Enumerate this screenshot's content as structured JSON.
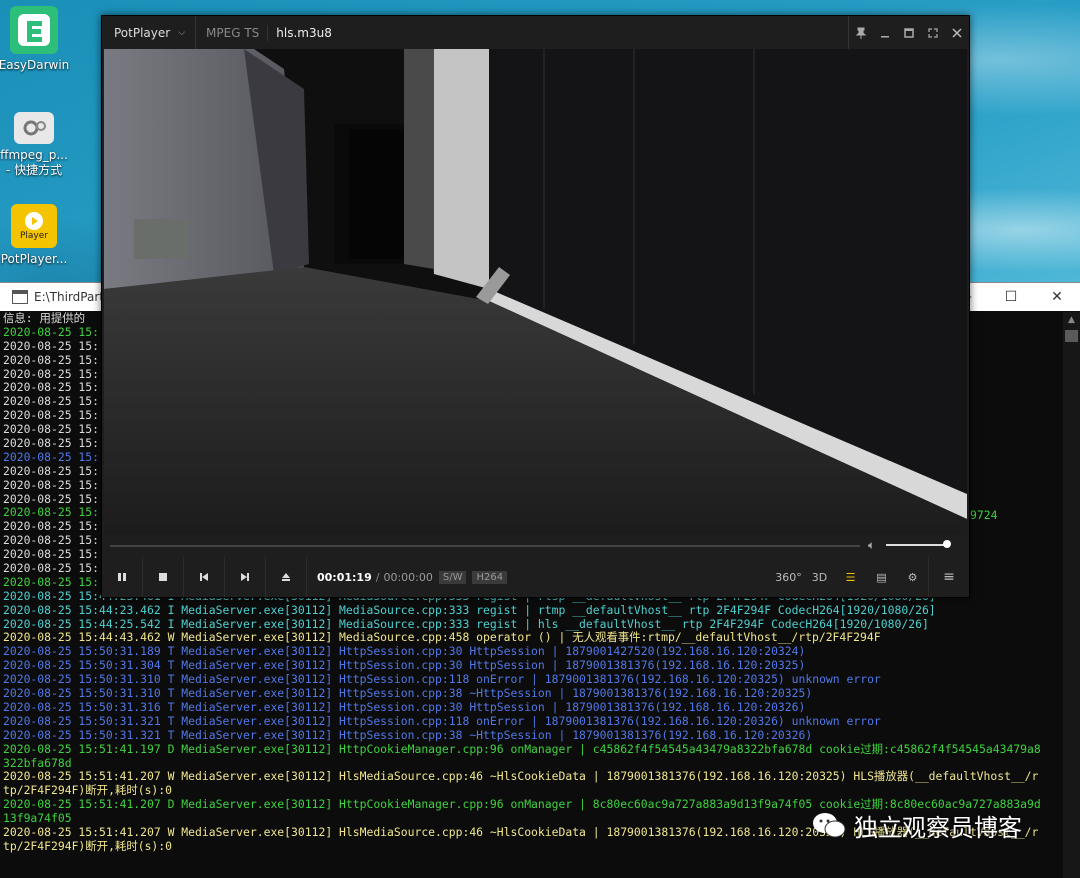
{
  "desktop": {
    "icons": [
      {
        "label": "EasyDarwin"
      },
      {
        "label": "ffmpeg_p...\n- 快捷方式"
      },
      {
        "label": "PotPlayer..."
      }
    ],
    "potplayer_icon_text": "Player"
  },
  "console": {
    "title": "E:\\ThirdPart",
    "window_controls": [
      "—",
      "☐",
      "✕"
    ],
    "right_overflow_fragment": "9724",
    "lines": [
      {
        "text": "信息: 用提供的",
        "color": "white"
      },
      {
        "text": "2020-08-25 15:",
        "color": "green"
      },
      {
        "text": "2020-08-25 15:",
        "color": "white"
      },
      {
        "text": "2020-08-25 15:",
        "color": "white"
      },
      {
        "text": "2020-08-25 15:",
        "color": "white"
      },
      {
        "text": "2020-08-25 15:",
        "color": "white"
      },
      {
        "text": "2020-08-25 15:",
        "color": "white"
      },
      {
        "text": "2020-08-25 15:",
        "color": "white"
      },
      {
        "text": "2020-08-25 15:",
        "color": "white"
      },
      {
        "text": "2020-08-25 15:",
        "color": "white"
      },
      {
        "text": "2020-08-25 15:",
        "color": "blue"
      },
      {
        "text": "2020-08-25 15:",
        "color": "white"
      },
      {
        "text": "2020-08-25 15:",
        "color": "white"
      },
      {
        "text": "2020-08-25 15:",
        "color": "white"
      },
      {
        "text": "2020-08-25 15:",
        "color": "green"
      },
      {
        "text": "2020-08-25 15:",
        "color": "white"
      },
      {
        "text": "2020-08-25 15:",
        "color": "white"
      },
      {
        "text": "2020-08-25 15:",
        "color": "white"
      },
      {
        "text": "2020-08-25 15:",
        "color": "white"
      },
      {
        "text": "2020-08-25 15:",
        "color": "green"
      },
      {
        "text": "2020-08-25 15:44:23.461 I MediaServer.exe[30112] MediaSource.cpp:333 regist | rtsp __defaultVhost__ rtp 2F4F294F CodecH264[1920/1080/26]",
        "color": "cyan"
      },
      {
        "text": "2020-08-25 15:44:23.462 I MediaServer.exe[30112] MediaSource.cpp:333 regist | rtmp __defaultVhost__ rtp 2F4F294F CodecH264[1920/1080/26]",
        "color": "cyan"
      },
      {
        "text": "2020-08-25 15:44:25.542 I MediaServer.exe[30112] MediaSource.cpp:333 regist | hls __defaultVhost__ rtp 2F4F294F CodecH264[1920/1080/26]",
        "color": "cyan"
      },
      {
        "text": "2020-08-25 15:44:43.462 W MediaServer.exe[30112] MediaSource.cpp:458 operator () | 无人观看事件:rtmp/__defaultVhost__/rtp/2F4F294F",
        "color": "yellow"
      },
      {
        "text": "2020-08-25 15:50:31.189 T MediaServer.exe[30112] HttpSession.cpp:30 HttpSession | 1879001427520(192.168.16.120:20324)",
        "color": "blue"
      },
      {
        "text": "2020-08-25 15:50:31.304 T MediaServer.exe[30112] HttpSession.cpp:30 HttpSession | 1879001381376(192.168.16.120:20325)",
        "color": "blue"
      },
      {
        "text": "2020-08-25 15:50:31.310 T MediaServer.exe[30112] HttpSession.cpp:118 onError | 1879001381376(192.168.16.120:20325) unknown error",
        "color": "blue"
      },
      {
        "text": "2020-08-25 15:50:31.310 T MediaServer.exe[30112] HttpSession.cpp:38 ~HttpSession | 1879001381376(192.168.16.120:20325)",
        "color": "blue"
      },
      {
        "text": "2020-08-25 15:50:31.316 T MediaServer.exe[30112] HttpSession.cpp:30 HttpSession | 1879001381376(192.168.16.120:20326)",
        "color": "blue"
      },
      {
        "text": "2020-08-25 15:50:31.321 T MediaServer.exe[30112] HttpSession.cpp:118 onError | 1879001381376(192.168.16.120:20326) unknown error",
        "color": "blue"
      },
      {
        "text": "2020-08-25 15:50:31.321 T MediaServer.exe[30112] HttpSession.cpp:38 ~HttpSession | 1879001381376(192.168.16.120:20326)",
        "color": "blue"
      },
      {
        "text": "2020-08-25 15:51:41.197 D MediaServer.exe[30112] HttpCookieManager.cpp:96 onManager | c45862f4f54545a43479a8322bfa678d cookie过期:c45862f4f54545a43479a8",
        "color": "green"
      },
      {
        "text": "322bfa678d",
        "color": "green"
      },
      {
        "text": "2020-08-25 15:51:41.207 W MediaServer.exe[30112] HlsMediaSource.cpp:46 ~HlsCookieData | 1879001381376(192.168.16.120:20325) HLS播放器(__defaultVhost__/r",
        "color": "yellow"
      },
      {
        "text": "tp/2F4F294F)断开,耗时(s):0",
        "color": "yellow"
      },
      {
        "text": "2020-08-25 15:51:41.207 D MediaServer.exe[30112] HttpCookieManager.cpp:96 onManager | 8c80ec60ac9a727a883a9d13f9a74f05 cookie过期:8c80ec60ac9a727a883a9d",
        "color": "green"
      },
      {
        "text": "13f9a74f05",
        "color": "green"
      },
      {
        "text": "2020-08-25 15:51:41.207 W MediaServer.exe[30112] HlsMediaSource.cpp:46 ~HlsCookieData | 1879001381376(192.168.16.120:20326) HLS播放器(__defaultVhost__/r",
        "color": "yellow"
      },
      {
        "text": "tp/2F4F294F)断开,耗时(s):0",
        "color": "yellow"
      }
    ]
  },
  "player": {
    "brand": "PotPlayer",
    "format": "MPEG TS",
    "file": "hls.m3u8",
    "title_controls": [
      "pin-icon",
      "minimize-icon",
      "maximize-icon",
      "fullscreen-icon",
      "close-icon"
    ],
    "time_current": "00:01:19",
    "time_separator": "/",
    "time_total": "00:00:00",
    "badge_sw": "S/W",
    "badge_codec": "H264",
    "tool_360": "360°",
    "tool_3d": "3D",
    "volume_level": 0.92
  },
  "watermark": {
    "text": "独立观察员博客"
  },
  "colors": {
    "white": "#dcdcdc",
    "green": "#3fd23f",
    "blue": "#5078e8",
    "yellow": "#f0e68c",
    "cyan": "#4fd0d0"
  }
}
